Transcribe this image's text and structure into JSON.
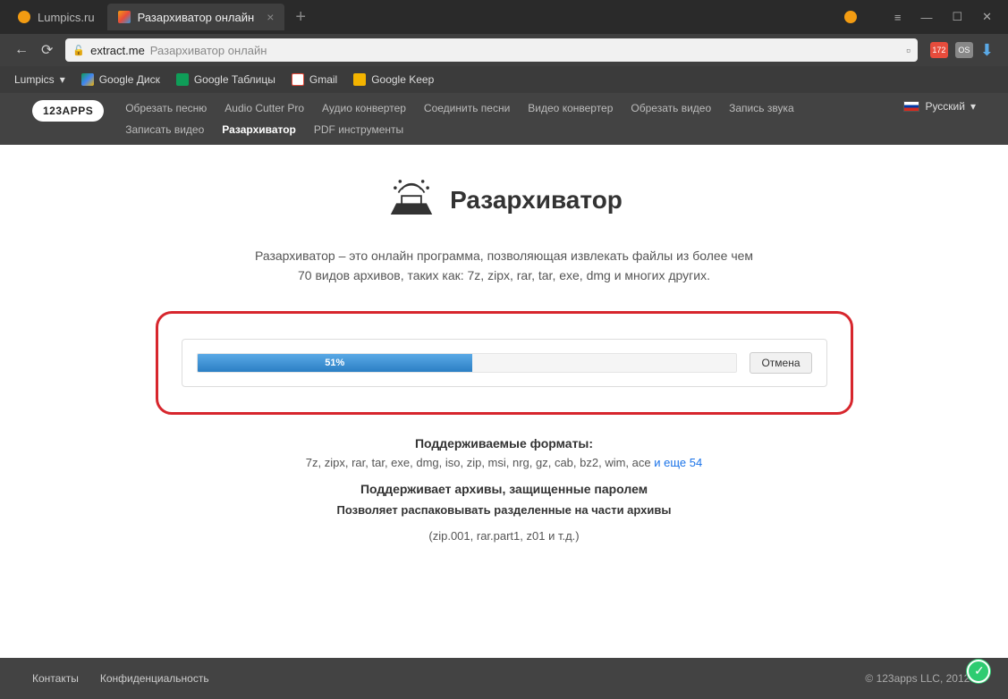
{
  "browser": {
    "tabs": [
      {
        "title": "Lumpics.ru"
      },
      {
        "title": "Разархиватор онлайн"
      }
    ],
    "url_domain": "extract.me",
    "url_rest": "Разархиватор онлайн",
    "ext_badge": "172",
    "bookmarks": {
      "lumpics": "Lumpics",
      "gdrive": "Google Диск",
      "gsheets": "Google Таблицы",
      "gmail": "Gmail",
      "gkeep": "Google Keep"
    }
  },
  "site": {
    "brand": "123APPS",
    "nav": {
      "cut_song": "Обрезать песню",
      "audio_cutter_pro": "Audio Cutter Pro",
      "audio_converter": "Аудио конвертер",
      "join_songs": "Соединить песни",
      "video_converter": "Видео конвертер",
      "cut_video": "Обрезать видео",
      "record_audio": "Запись звука",
      "record_video": "Записать видео",
      "unarchiver": "Разархиватор",
      "pdf_tools": "PDF инструменты"
    },
    "language": "Русский"
  },
  "hero": {
    "title": "Разархиватор",
    "desc_line1": "Разархиватор – это онлайн программа, позволяющая извлекать файлы из более чем",
    "desc_line2": "70 видов архивов, таких как: 7z, zipx, rar, tar, exe, dmg и многих других."
  },
  "upload": {
    "progress_percent": 51,
    "progress_label": "51%",
    "cancel": "Отмена"
  },
  "formats": {
    "heading": "Поддерживаемые форматы:",
    "list": "7z, zipx, rar, tar, exe, dmg, iso, zip, msi, nrg, gz, cab, bz2, wim, ace ",
    "more": "и еще 54",
    "password": "Поддерживает архивы, защищенные паролем",
    "split1": "Позволяет распаковывать разделенные на части архивы",
    "split2": "(zip.001, rar.part1, z01 и т.д.)"
  },
  "footer": {
    "contacts": "Контакты",
    "privacy": "Конфиденциальность",
    "copyright": "© 123apps LLC, 2012–"
  }
}
